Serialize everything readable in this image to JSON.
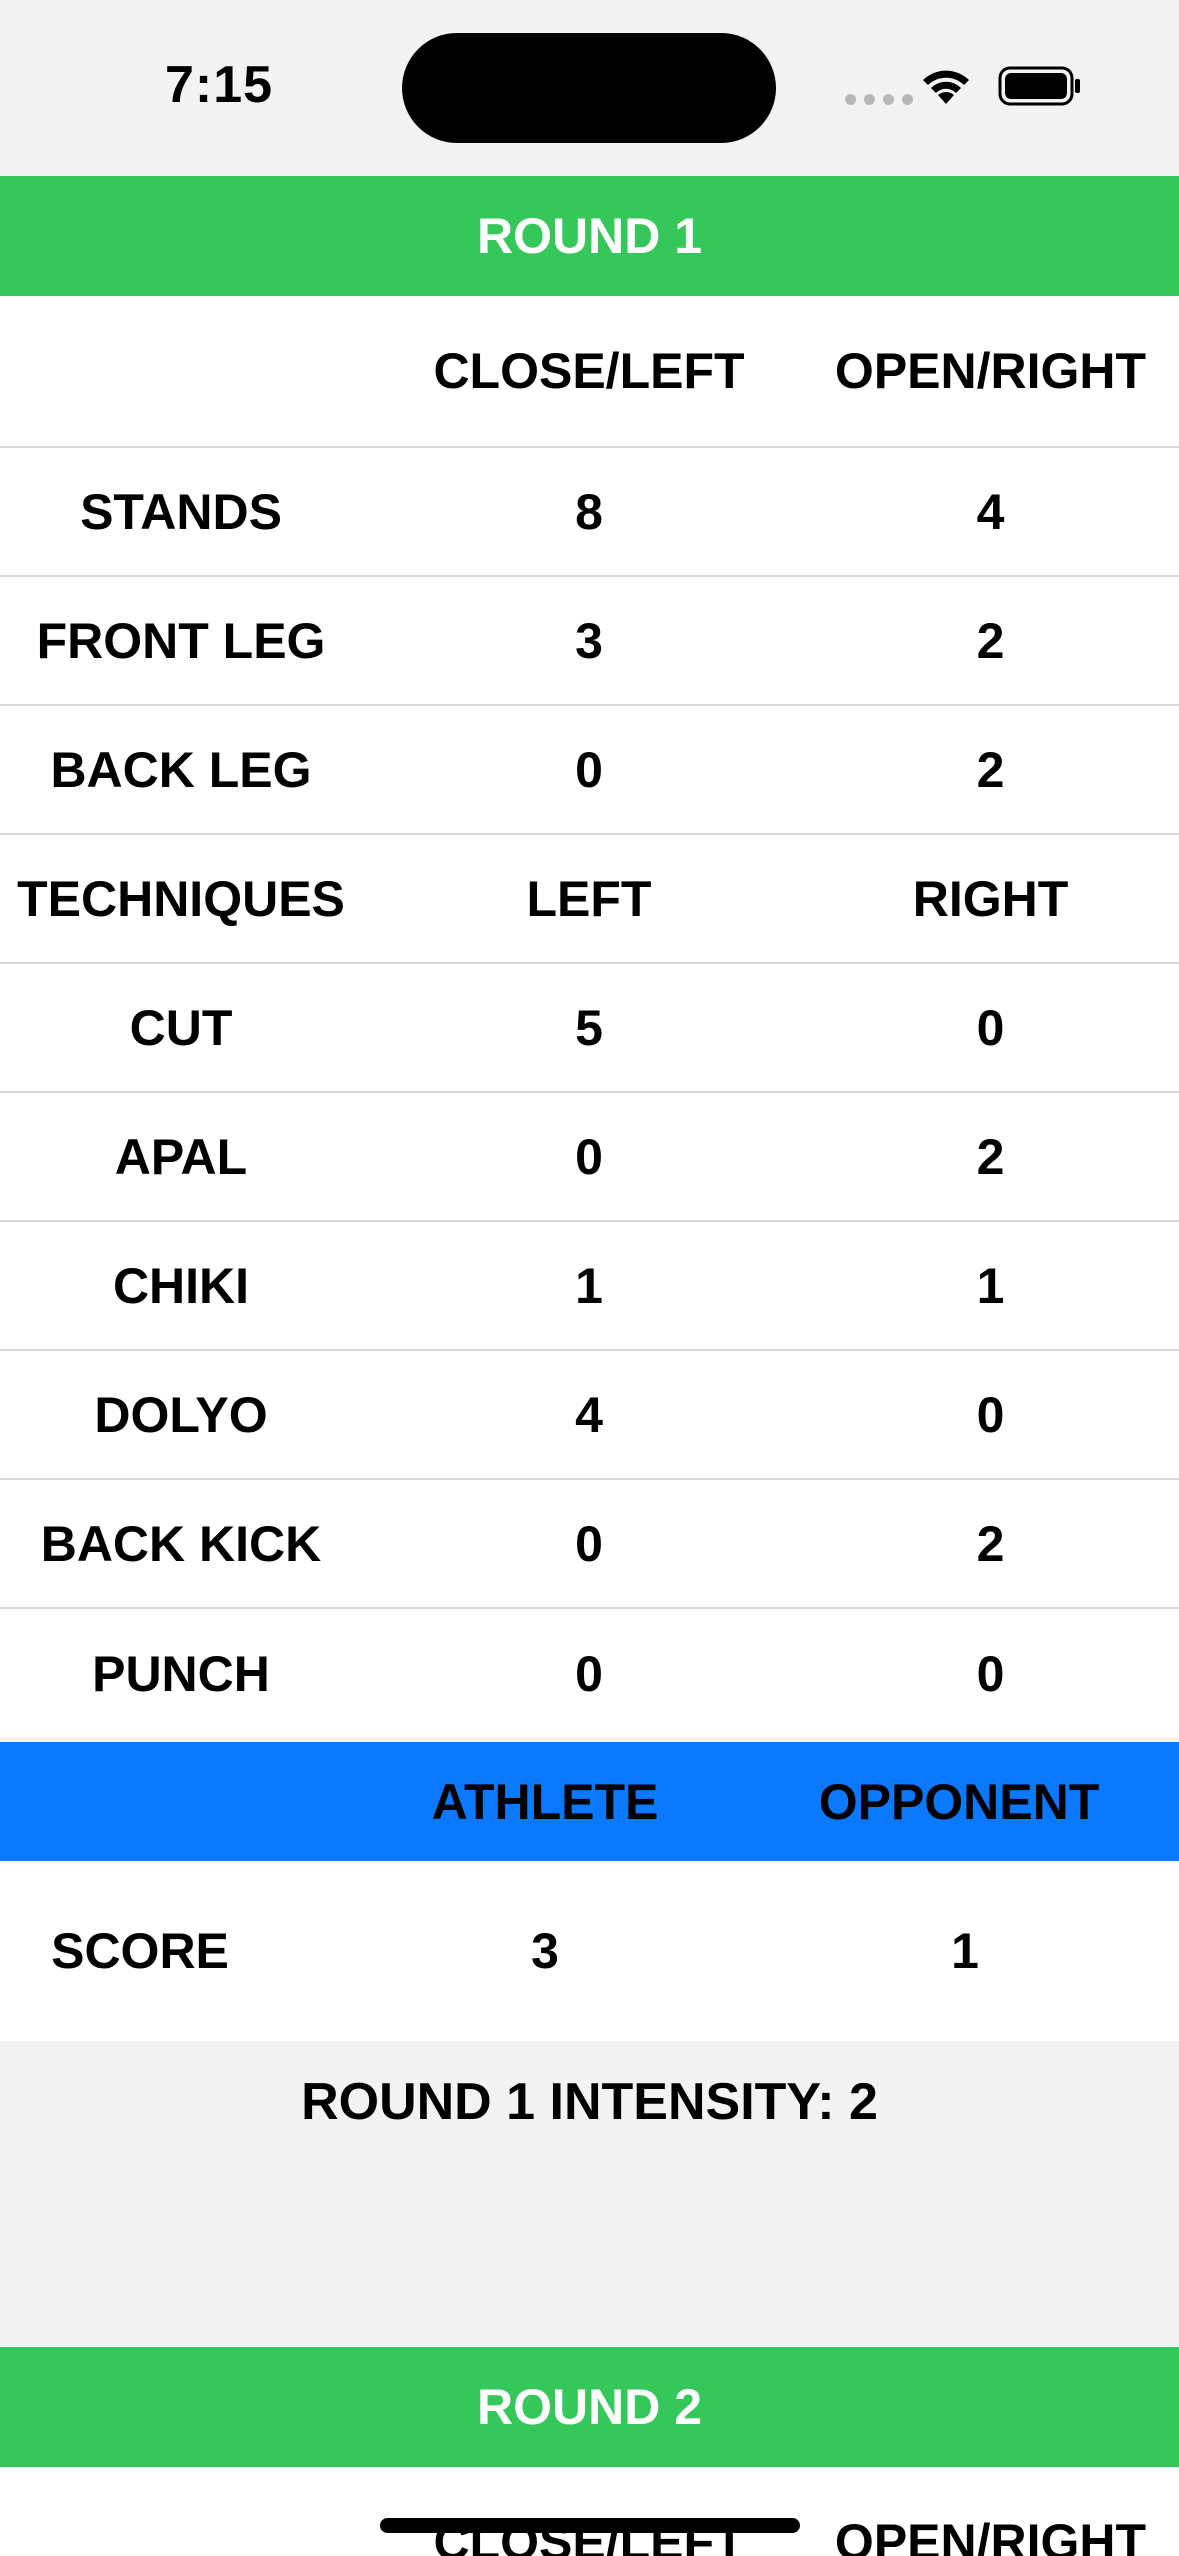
{
  "status_bar": {
    "time": "7:15"
  },
  "round1": {
    "title": "ROUND 1",
    "columns": [
      "",
      "CLOSE/LEFT",
      "OPEN/RIGHT"
    ],
    "rows": [
      {
        "label": "STANDS",
        "a": "8",
        "b": "4"
      },
      {
        "label": "FRONT LEG",
        "a": "3",
        "b": "2"
      },
      {
        "label": "BACK LEG",
        "a": "0",
        "b": "2"
      },
      {
        "label": "TECHNIQUES",
        "a": "LEFT",
        "b": "RIGHT"
      },
      {
        "label": "CUT",
        "a": "5",
        "b": "0"
      },
      {
        "label": "APAL",
        "a": "0",
        "b": "2"
      },
      {
        "label": "CHIKI",
        "a": "1",
        "b": "1"
      },
      {
        "label": "DOLYO",
        "a": "4",
        "b": "0"
      },
      {
        "label": "BACK KICK",
        "a": "0",
        "b": "2"
      },
      {
        "label": "PUNCH",
        "a": "0",
        "b": "0"
      }
    ],
    "score_header": {
      "athlete": "ATHLETE",
      "opponent": "OPPONENT"
    },
    "score": {
      "label": "SCORE",
      "athlete": "3",
      "opponent": "1"
    },
    "intensity": "ROUND 1 INTENSITY: 2"
  },
  "round2": {
    "title": "ROUND 2",
    "columns": [
      "",
      "CLOSE/LEFT",
      "OPEN/RIGHT"
    ]
  },
  "colors": {
    "round_header": "#36c75a",
    "score_header": "#0a79fd",
    "background": "#f3f3f3"
  }
}
